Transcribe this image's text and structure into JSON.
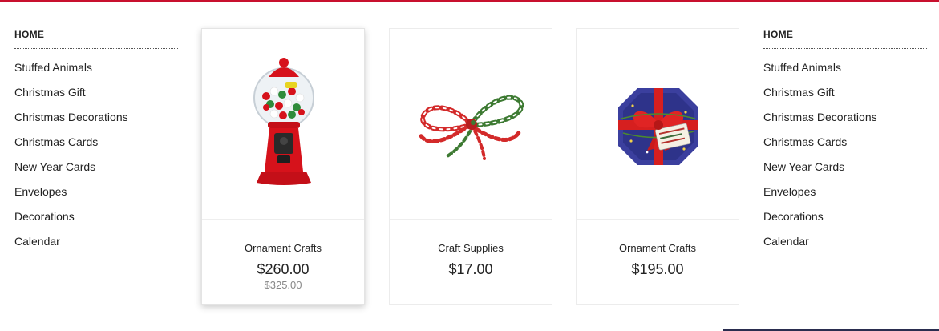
{
  "colors": {
    "accent": "#c8102e"
  },
  "menu_left": {
    "home": "HOME",
    "items": [
      "Stuffed Animals",
      "Christmas Gift",
      "Christmas Decorations",
      "Christmas Cards",
      "New Year Cards",
      "Envelopes",
      "Decorations",
      "Calendar"
    ]
  },
  "menu_right": {
    "home": "HOME",
    "items": [
      "Stuffed Animals",
      "Christmas Gift",
      "Christmas Decorations",
      "Christmas Cards",
      "New Year Cards",
      "Envelopes",
      "Decorations",
      "Calendar"
    ]
  },
  "products": [
    {
      "name": "Ornament Crafts",
      "price": "$260.00",
      "old_price": "$325.00",
      "image": "gumball-machine"
    },
    {
      "name": "Craft Supplies",
      "price": "$17.00",
      "image": "bakers-twine"
    },
    {
      "name": "Ornament Crafts",
      "price": "$195.00",
      "image": "christmas-gift-tin"
    }
  ]
}
